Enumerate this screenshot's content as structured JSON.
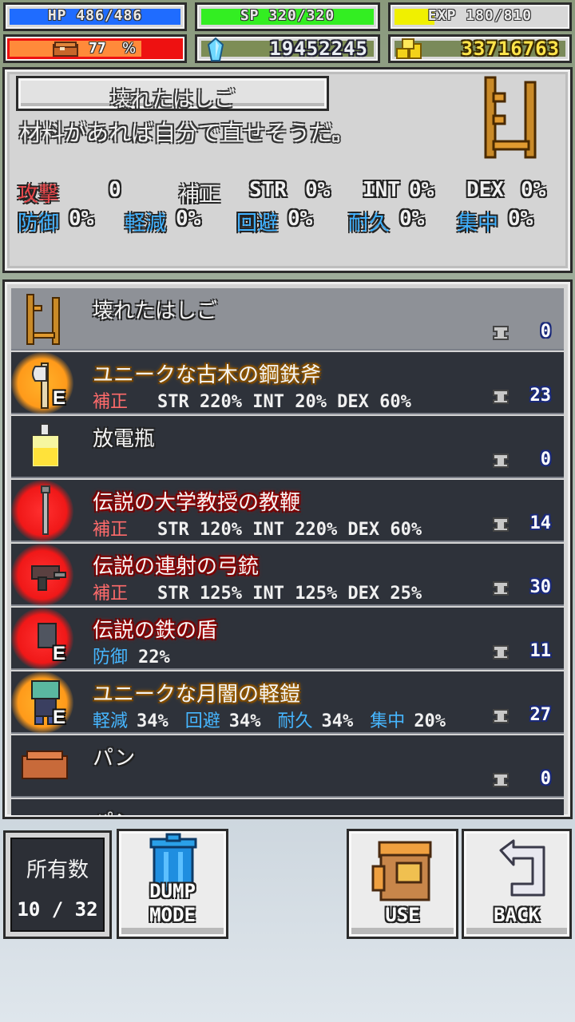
{
  "status": {
    "hp": "HP  486/486",
    "sp": "SP  320/320",
    "exp": "EXP  180/810",
    "stamina_value": "77",
    "stamina_unit": "%",
    "gems": "19452245",
    "gold": "33716763"
  },
  "detail": {
    "title": "壊れたはしご",
    "description": "材料があれば自分で直せそうだ。",
    "attack_label": "攻撃",
    "attack_value": "0",
    "bonus_label": "補正",
    "str_label": "STR",
    "str_value": "0%",
    "int_label": "INT",
    "int_value": "0%",
    "dex_label": "DEX",
    "dex_value": "0%",
    "defense_label": "防御",
    "defense_value": "0%",
    "reduce_label": "軽減",
    "reduce_value": "0%",
    "evade_label": "回避",
    "evade_value": "0%",
    "durability_label": "耐久",
    "durability_value": "0%",
    "focus_label": "集中",
    "focus_value": "0%"
  },
  "items": [
    {
      "name": "壊れたはしご",
      "stats": "",
      "count": "0"
    },
    {
      "name": "ユニークな古木の鋼鉄斧",
      "stat_label": "補正",
      "stats": "STR 220% INT  20% DEX 60%",
      "equip": "E",
      "count": "23"
    },
    {
      "name": "放電瓶",
      "stats": "",
      "count": "0"
    },
    {
      "name": "伝説の大学教授の教鞭",
      "stat_label": "補正",
      "stats": "STR 120% INT 220% DEX 60%",
      "count": "14"
    },
    {
      "name": "伝説の連射の弓銃",
      "stat_label": "補正",
      "stats": "STR 125% INT  125% DEX 25%",
      "count": "30"
    },
    {
      "name": "伝説の鉄の盾",
      "stat_label": "防御",
      "stats": "22%",
      "equip": "E",
      "count": "11"
    },
    {
      "name": "ユニークな月闇の軽鎧",
      "l1": "軽減",
      "v1": "34%",
      "l2": "回避",
      "v2": "34%",
      "l3": "耐久",
      "v3": "34%",
      "l4": "集中",
      "v4": "20%",
      "equip": "E",
      "count": "27"
    },
    {
      "name": "パン",
      "stats": "",
      "count": "0"
    },
    {
      "name": "パン",
      "stats": "",
      "count": ""
    }
  ],
  "bottom": {
    "count_label": "所有数",
    "count_value": "10 / 32",
    "dump_label_1": "DUMP",
    "dump_label_2": "MODE",
    "use_label": "USE",
    "back_label": "BACK"
  },
  "colors": {
    "hp": "#1f6cff",
    "sp": "#33ee22",
    "exp": "#f0f000",
    "stamina": "#ee1111",
    "gold_text": "#ffe44a",
    "unique_glow": "#ffa020",
    "legend_glow": "#ff2020"
  },
  "icons": {
    "detail": "broken-ladder-icon",
    "gems": "crystal-icon",
    "gold": "coin-stack-icon",
    "stamina": "bread-icon",
    "count": "anvil-icon",
    "dump": "trash-can-icon",
    "use": "backpack-icon",
    "back": "return-arrow-icon"
  }
}
